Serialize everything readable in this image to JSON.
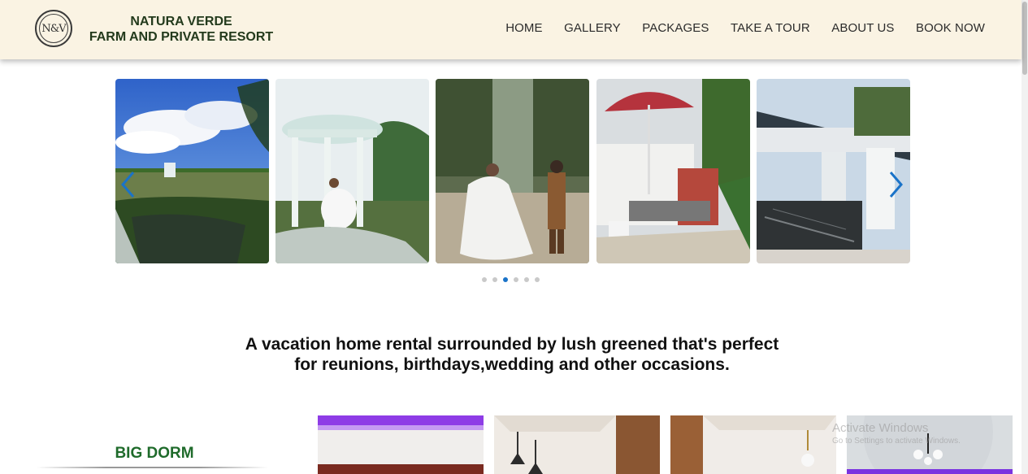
{
  "brand": {
    "line1": "NATURA VERDE",
    "line2": "FARM AND PRIVATE RESORT",
    "logo_text": "N&V"
  },
  "nav": {
    "items": [
      "HOME",
      "GALLERY",
      "PACKAGES",
      "TAKE A TOUR",
      "ABOUT US",
      "BOOK NOW"
    ]
  },
  "carousel": {
    "slides": [
      "garden-pond",
      "gazebo-wedding",
      "wedding-couple",
      "red-umbrella-bbq",
      "pool-cabana"
    ],
    "dots_total": 6,
    "active_dot": 3
  },
  "tagline": {
    "line1": "A vacation home rental surrounded by lush greened that's perfect",
    "line2": "for reunions, birthdays,wedding and other occasions."
  },
  "dorm": {
    "title": "BIG DORM"
  },
  "watermark": {
    "title": "Activate Windows",
    "sub": "Go to Settings to activate Windows."
  },
  "colors": {
    "header_bg": "#faf3e3",
    "brand_text": "#233a1c",
    "dorm_title": "#1f6b2b",
    "arrow": "#1a73c8",
    "active_dot": "#1a73c8"
  }
}
